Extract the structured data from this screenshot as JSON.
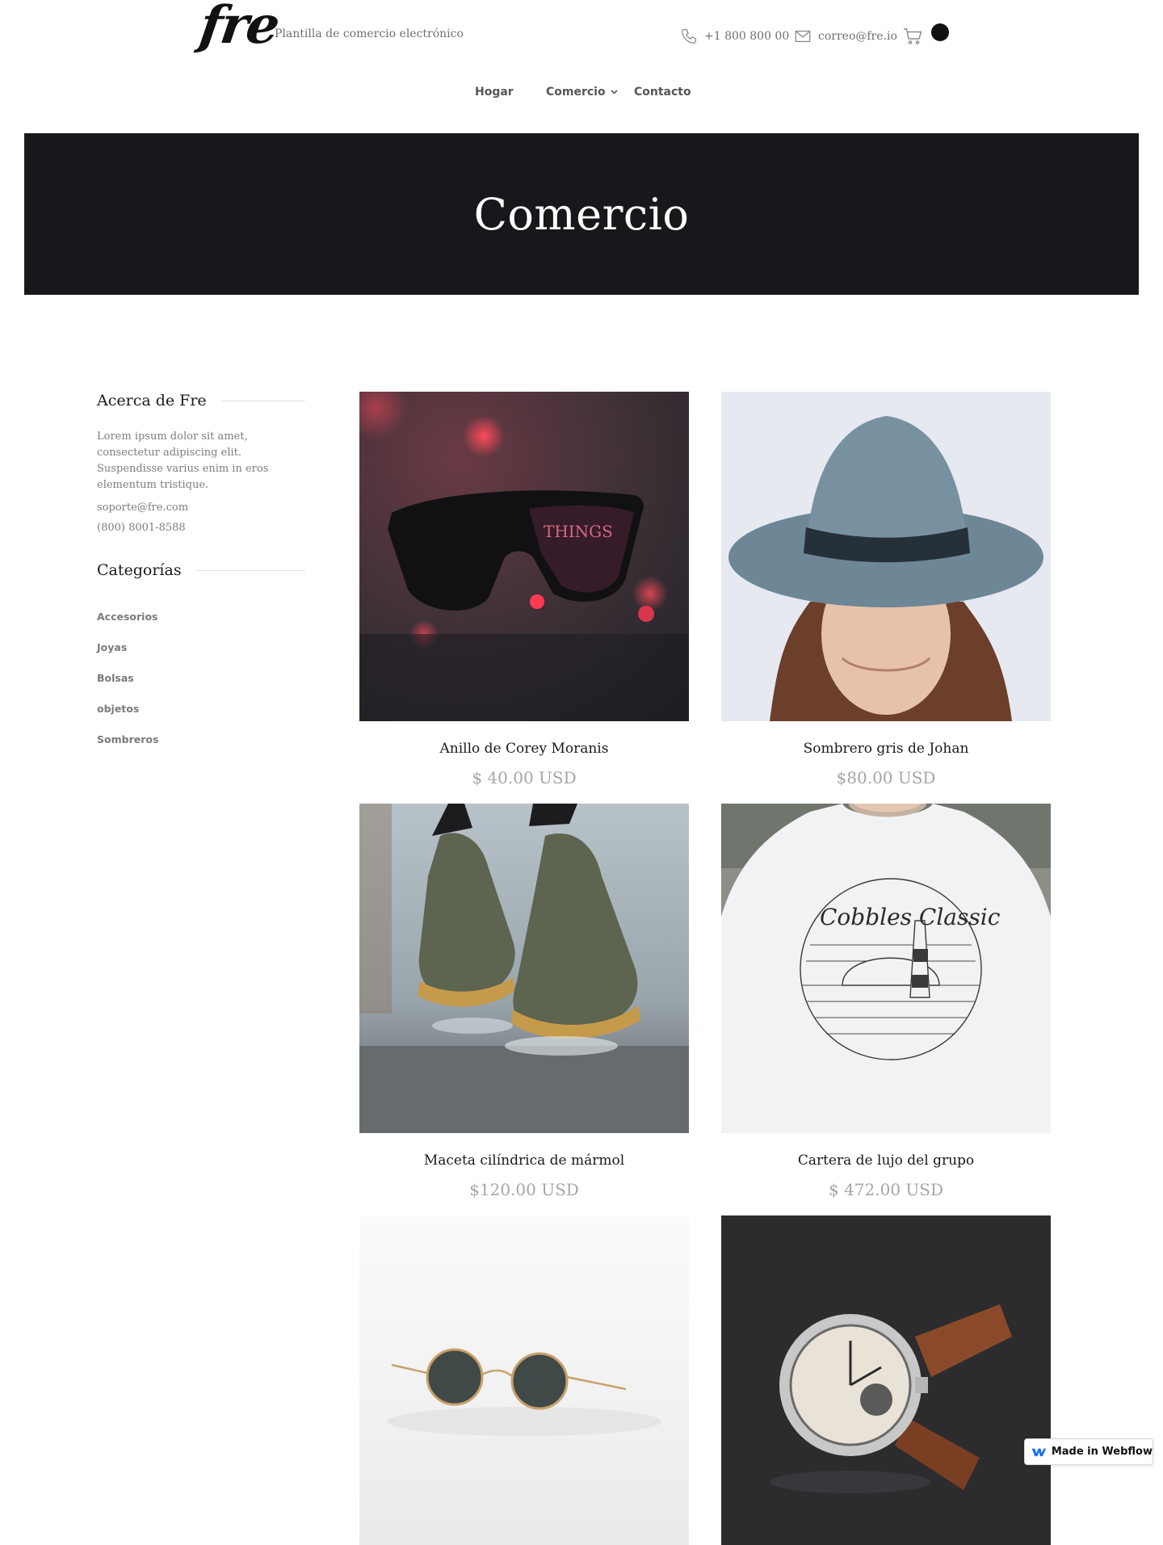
{
  "header": {
    "logo": "fre",
    "tagline": "Plantilla de comercio electrónico",
    "phone": "+1 800 800 00",
    "email": "correo@fre.io",
    "icons": [
      "phone-icon",
      "mail-icon",
      "cart-icon"
    ]
  },
  "nav": {
    "items": [
      {
        "label": "Hogar"
      },
      {
        "label": "Comercio",
        "has_dropdown": true
      },
      {
        "label": "Contacto"
      }
    ]
  },
  "hero": {
    "title": "Comercio",
    "background": "#17171c"
  },
  "sidebar": {
    "about_heading": "Acerca de Fre",
    "about_text": "Lorem ipsum dolor sit amet, consectetur adipiscing elit. Suspendisse varius enim in eros elementum tristique.",
    "email": "soporte@fre.com",
    "phone": "(800) 8001-8588",
    "categories_heading": "Categorías",
    "categories": [
      "Accesorios",
      "Joyas",
      "Bolsas",
      "objetos",
      "Sombreros"
    ]
  },
  "products": [
    {
      "name": "Anillo de Corey Moranis",
      "price": "$ 40.00 USD",
      "image": "sunglasses-neon-photo"
    },
    {
      "name": "Sombrero gris de Johan",
      "price": "$80.00 USD",
      "image": "grey-hat-woman-photo"
    },
    {
      "name": "Maceta cilíndrica de mármol",
      "price": "$120.00 USD",
      "image": "green-sneakers-splash-photo"
    },
    {
      "name": "Cartera de lujo del grupo",
      "price": "$ 472.00 USD",
      "image": "white-tshirt-photo"
    },
    {
      "name": "",
      "price": "",
      "image": "round-sunglasses-photo"
    },
    {
      "name": "",
      "price": "",
      "image": "wristwatch-photo"
    }
  ],
  "badge": {
    "label": "Made in Webflow"
  },
  "colors": {
    "text": "#1a1a1f",
    "muted": "#7d7d82",
    "price": "#a6a6aa",
    "accent_webflow": "#146ef5"
  }
}
